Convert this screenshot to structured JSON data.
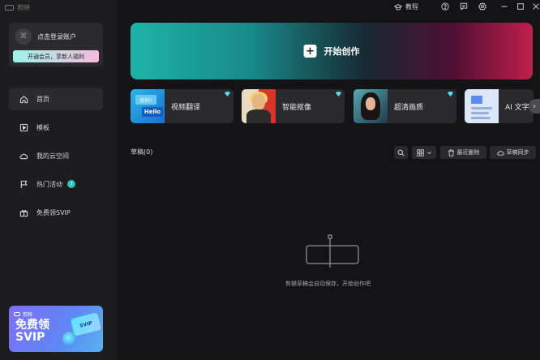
{
  "app": {
    "logo_text": "剪映"
  },
  "topbar": {
    "tutorial_label": "教程"
  },
  "account": {
    "login_label": "点击登录账户",
    "vip_promo": "开通会员，享新人福利"
  },
  "nav": [
    {
      "label": "首页",
      "active": true
    },
    {
      "label": "模板"
    },
    {
      "label": "我的云空间"
    },
    {
      "label": "热门活动",
      "badge": "7"
    },
    {
      "label": "免费领SVIP"
    }
  ],
  "promo": {
    "logo_text": "剪映",
    "title_line1": "免费领",
    "title_line2": "SVIP",
    "card_text": "SVIP"
  },
  "create": {
    "label": "开始创作"
  },
  "features": [
    {
      "label": "视频翻译",
      "thumb_text_1": "你好!",
      "thumb_text_2": "Hello"
    },
    {
      "label": "智能抠像"
    },
    {
      "label": "超清画质"
    },
    {
      "label": "AI 文字"
    }
  ],
  "drafts": {
    "title": "草稿(0)",
    "recent_delete": "最近删除",
    "sync": "草稿同步",
    "empty_text": "剪辑草稿会自动保存，开始创作吧"
  },
  "colors": {
    "accent": "#2dc3c0",
    "background": "#141416",
    "sidebar": "#1d1d20",
    "card": "#2a2a2e"
  }
}
